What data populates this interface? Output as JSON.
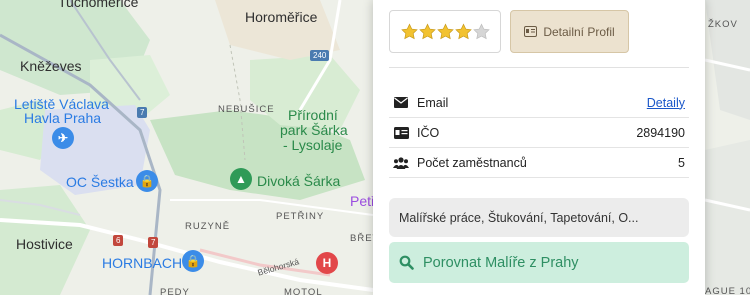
{
  "map": {
    "labels": {
      "suchomesti": "Tuchoměřice",
      "horomerice": "Horoměřice",
      "knezeves": "Kněževes",
      "letiste": "Letiště Václava\nHavla Praha",
      "nebusice": "NEBUŠICE",
      "park": "Přírodní\npark Šárka\n- Lysolaje",
      "oc_sestka": "OC Šestka",
      "divoka": "Divoká Šárka",
      "ruzyne": "RUZYNĚ",
      "petriny": "PETŘINY",
      "hostivice": "Hostivice",
      "hornbach": "HORNBACH",
      "belohorska": "Bělohorská",
      "motol": "MOTOL",
      "petrin_partial": "Petř",
      "brev": "BŘEV",
      "zkov": "ŽKOV",
      "ague": "AGUE 10",
      "road_240": "240",
      "road_7": "7",
      "road_6": "6",
      "road_7b": "7",
      "pedy": "PEDY",
      "letiste_line1": "Letiště Václava",
      "letiste_line2": "Havla Praha",
      "park_line1": "Přírodní",
      "park_line2": "park Šárka",
      "park_line3": "- Lysolaje"
    }
  },
  "card": {
    "rating": {
      "value": 4,
      "max": 5
    },
    "profile_button": "Detailní Profil",
    "rows": [
      {
        "icon": "envelope-icon",
        "label": "Email",
        "value": "Detaily",
        "is_link": true
      },
      {
        "icon": "id-card-icon",
        "label": "IČO",
        "value": "2894190",
        "is_link": false
      },
      {
        "icon": "users-icon",
        "label": "Počet zaměstnanců",
        "value": "5",
        "is_link": false
      }
    ],
    "categories": "Malířské práce, Štukování, Tapetování, O...",
    "compare_button": "Porovnat Malíře z Prahy",
    "colors": {
      "star": "#f2c230",
      "star_empty": "#d6d6d6",
      "profile_bg": "#ece2cf",
      "compare_bg": "#cdeede",
      "compare_text": "#2e8f63",
      "link": "#1a57c9"
    }
  }
}
